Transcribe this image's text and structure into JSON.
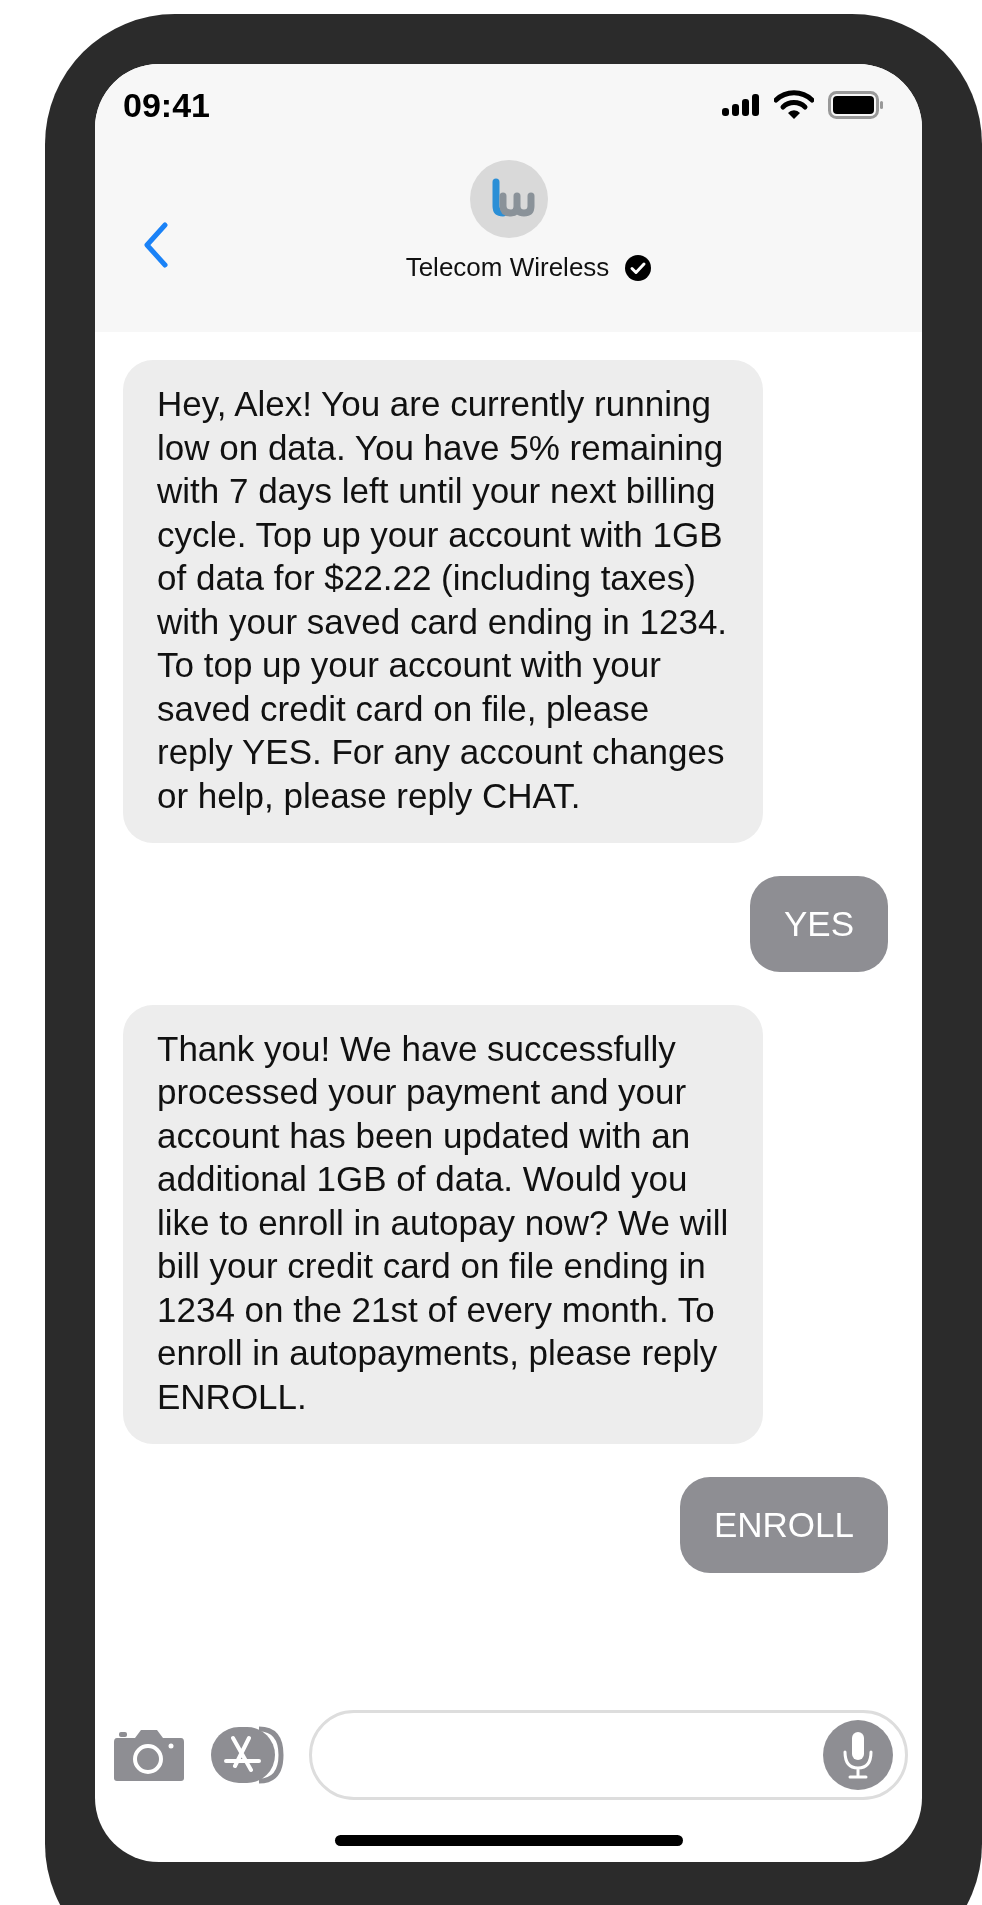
{
  "status_bar": {
    "time": "09:41"
  },
  "contact": {
    "name": "Telecom Wireless",
    "verified": true
  },
  "messages": [
    {
      "kind": "received",
      "text": "Hey, Alex! You are currently running low on data. You have 5% remaining with 7 days left until your next billing cycle. Top up your account with 1GB of data for $22.22 (including taxes) with your saved card ending in 1234. To top up your account with your saved credit card on file, please reply YES. For any account changes or help, please reply CHAT."
    },
    {
      "kind": "sent",
      "text": "YES"
    },
    {
      "kind": "received",
      "text": "Thank you! We have successfully processed your payment and your account has been updated with an additional 1GB of data. Would you like to enroll in autopay now? We will bill your credit card on file ending in 1234 on the 21st of every month. To enroll in autopayments, please reply ENROLL."
    },
    {
      "kind": "sent",
      "text": "ENROLL"
    }
  ]
}
